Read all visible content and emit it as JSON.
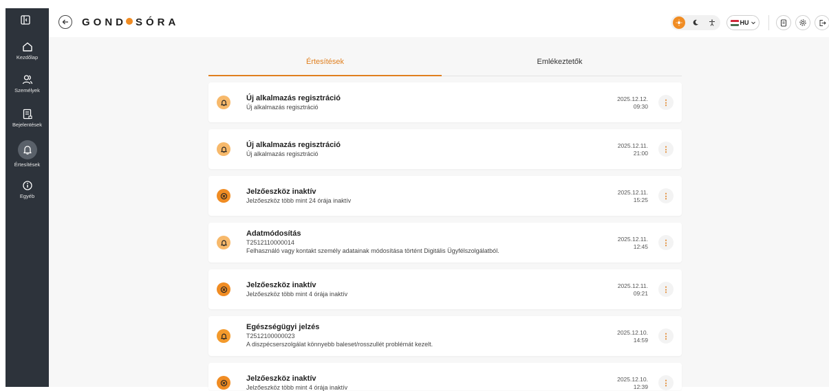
{
  "brand": {
    "left": "GOND",
    "right": "SÓRA"
  },
  "sidebar": {
    "items": [
      {
        "label": "Kezdőlap",
        "icon": "home-icon"
      },
      {
        "label": "Személyek",
        "icon": "users-icon"
      },
      {
        "label": "Bejelentések",
        "icon": "report-icon"
      },
      {
        "label": "Értesítések",
        "icon": "bell-icon",
        "active": true
      },
      {
        "label": "Egyéb",
        "icon": "info-icon"
      }
    ]
  },
  "header": {
    "language": "HU"
  },
  "tabs": [
    {
      "label": "Értesítések",
      "active": true
    },
    {
      "label": "Emlékeztetők",
      "active": false
    }
  ],
  "notifications": [
    {
      "type": "bell",
      "title": "Új alkalmazás regisztráció",
      "lines": [
        "Új alkalmazás regisztráció"
      ],
      "date": "2025.12.12.",
      "time": "09:30"
    },
    {
      "type": "bell",
      "title": "Új alkalmazás regisztráció",
      "lines": [
        "Új alkalmazás regisztráció"
      ],
      "date": "2025.12.11.",
      "time": "21:00"
    },
    {
      "type": "x",
      "title": "Jelzőeszköz inaktív",
      "lines": [
        "Jelzőeszköz több mint 24 órája inaktív"
      ],
      "date": "2025.12.11.",
      "time": "15:25"
    },
    {
      "type": "bell",
      "title": "Adatmódosítás",
      "lines": [
        "T2512110000014",
        "Felhasználó vagy kontakt személy adatainak módosítása történt Digitális Ügyfélszolgálatból."
      ],
      "date": "2025.12.11.",
      "time": "12:45"
    },
    {
      "type": "x",
      "title": "Jelzőeszköz inaktív",
      "lines": [
        "Jelzőeszköz több mint 4 órája inaktív"
      ],
      "date": "2025.12.11.",
      "time": "09:21"
    },
    {
      "type": "bell-strong",
      "title": "Egészségügyi jelzés",
      "lines": [
        "T2512100000023",
        "A diszpécserszolgálat könnyebb baleset/rosszullét problémát kezelt."
      ],
      "date": "2025.12.10.",
      "time": "14:59"
    },
    {
      "type": "x",
      "title": "Jelzőeszköz inaktív",
      "lines": [
        "Jelzőeszköz több mint 4 órája inaktív"
      ],
      "date": "2025.12.10.",
      "time": "12:39"
    }
  ],
  "colors": {
    "accent": "#f08c23",
    "sidebar": "#2d333b",
    "background": "#f7f7f7"
  }
}
